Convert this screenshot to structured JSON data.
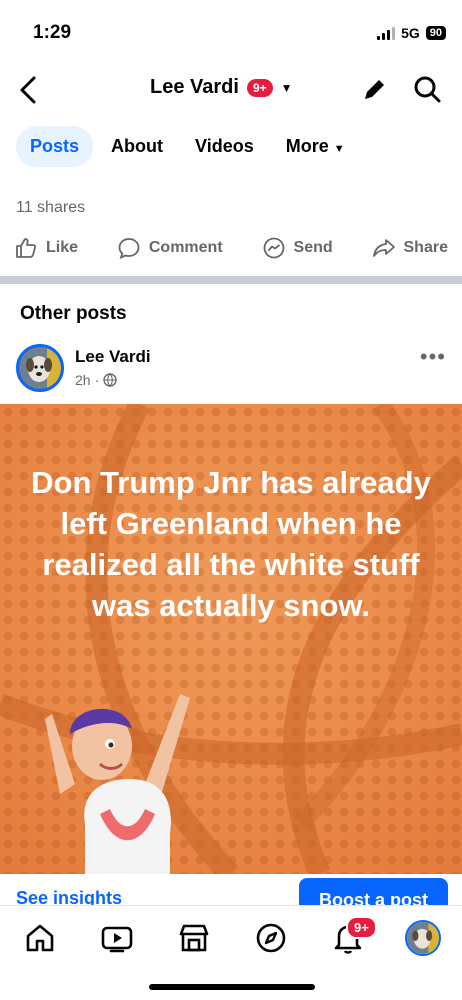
{
  "status_bar": {
    "time": "1:29",
    "network": "5G",
    "battery": "90"
  },
  "header": {
    "title": "Lee Vardi",
    "notification_count": "9+"
  },
  "tabs": [
    {
      "label": "Posts",
      "active": true
    },
    {
      "label": "About",
      "active": false
    },
    {
      "label": "Videos",
      "active": false
    },
    {
      "label": "More",
      "active": false
    }
  ],
  "post_stats": {
    "shares": "11 shares"
  },
  "actions": {
    "like": "Like",
    "comment": "Comment",
    "send": "Send",
    "share": "Share"
  },
  "other_posts": {
    "heading": "Other posts",
    "author": "Lee Vardi",
    "time": "2h",
    "separator": "·",
    "image_text": "Don Trump Jnr has already left Greenland when he realized all the white stuff was actually snow.",
    "insights_label": "See insights",
    "boost_label": "Boost a post"
  },
  "tabbar": {
    "notification_count": "9+"
  },
  "colors": {
    "accent": "#0866ff",
    "badge": "#e41e3f",
    "post_bg": "#e98847"
  }
}
